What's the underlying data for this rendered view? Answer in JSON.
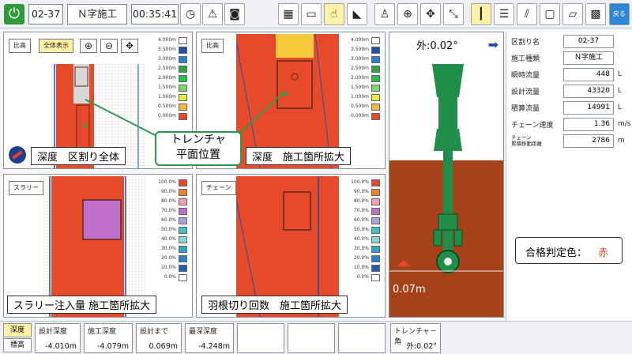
{
  "toolbar": {
    "section_id": "02-37",
    "work_type": "Ｎ字施工",
    "elapsed_time": "00:35:41",
    "back_label": "戻る"
  },
  "panels": {
    "depth_full": {
      "button_left": "比高",
      "button_right": "全体表示",
      "caption": "深度　区割り全体"
    },
    "depth_zoom": {
      "button": "比高",
      "caption": "深度　施工箇所拡大"
    },
    "slurry": {
      "button": "スラリー",
      "caption": "スラリー注入量 施工箇所拡大"
    },
    "chain": {
      "button": "チェーン",
      "caption": "羽根切り回数　施工箇所拡大"
    }
  },
  "legend_depth": {
    "labels": [
      "4.000m",
      "3.500m",
      "3.000m",
      "2.500m",
      "2.000m",
      "1.500m",
      "1.000m",
      "0.500m",
      "0.000m"
    ],
    "colors": [
      "#ffffff",
      "#1f4fa8",
      "#2c7fd0",
      "#2ea34a",
      "#24c048",
      "#7fd86a",
      "#e8ec3a",
      "#f6b83c",
      "#e64a2a"
    ]
  },
  "legend_percent": {
    "labels": [
      "100.0%",
      "90.0%",
      "80.0%",
      "70.0%",
      "60.0%",
      "50.0%",
      "40.0%",
      "30.0%",
      "20.0%",
      "10.0%",
      "0.0%"
    ],
    "colors": [
      "#e64a2a",
      "#f08030",
      "#f4a0b0",
      "#c070c8",
      "#a8a8d8",
      "#48c0c0",
      "#88d8d8",
      "#2ea3c8",
      "#2a7fc8",
      "#1f5fb0",
      "#ffffff"
    ]
  },
  "callout": {
    "line1": "トレンチャ",
    "line2": "平面位置"
  },
  "trencher_view": {
    "angle_label": "外:0.02°",
    "depth_label": "0.07m"
  },
  "info": {
    "rows": [
      {
        "label": "区割り名",
        "value": "02-37",
        "unit": ""
      },
      {
        "label": "施工種類",
        "value": "Ｎ字施工",
        "unit": ""
      },
      {
        "label": "瞬時流量",
        "value": "448",
        "unit": "L"
      },
      {
        "label": "設計流量",
        "value": "43320",
        "unit": "L"
      },
      {
        "label": "積算流量",
        "value": "14991",
        "unit": "L"
      },
      {
        "label": "チェーン速度",
        "value": "1.36",
        "unit": "m/s"
      },
      {
        "label": "チェーン\n累積移動距離",
        "value": "2786",
        "unit": "m"
      }
    ],
    "pass_label": "合格判定色：",
    "pass_color_name": "赤"
  },
  "bottom": {
    "tab_depth": "深度",
    "tab_elev": "標高",
    "design_depth_label": "設計深度",
    "design_depth_value": "-4.010m",
    "work_depth_label": "施工深度",
    "work_depth_value": "-4.079m",
    "to_design_label": "設計まで",
    "to_design_value": "0.069m",
    "deepest_label": "最深深度",
    "deepest_value": "-4.248m",
    "trencher_angle_label": "トレンチャ－角",
    "trencher_angle_value": "外:0.02°"
  },
  "colors": {
    "accent_green": "#2f9a3a",
    "red_fill": "#e64a2a",
    "soil": "#a5421a",
    "trencher": "#1f8e4a"
  }
}
